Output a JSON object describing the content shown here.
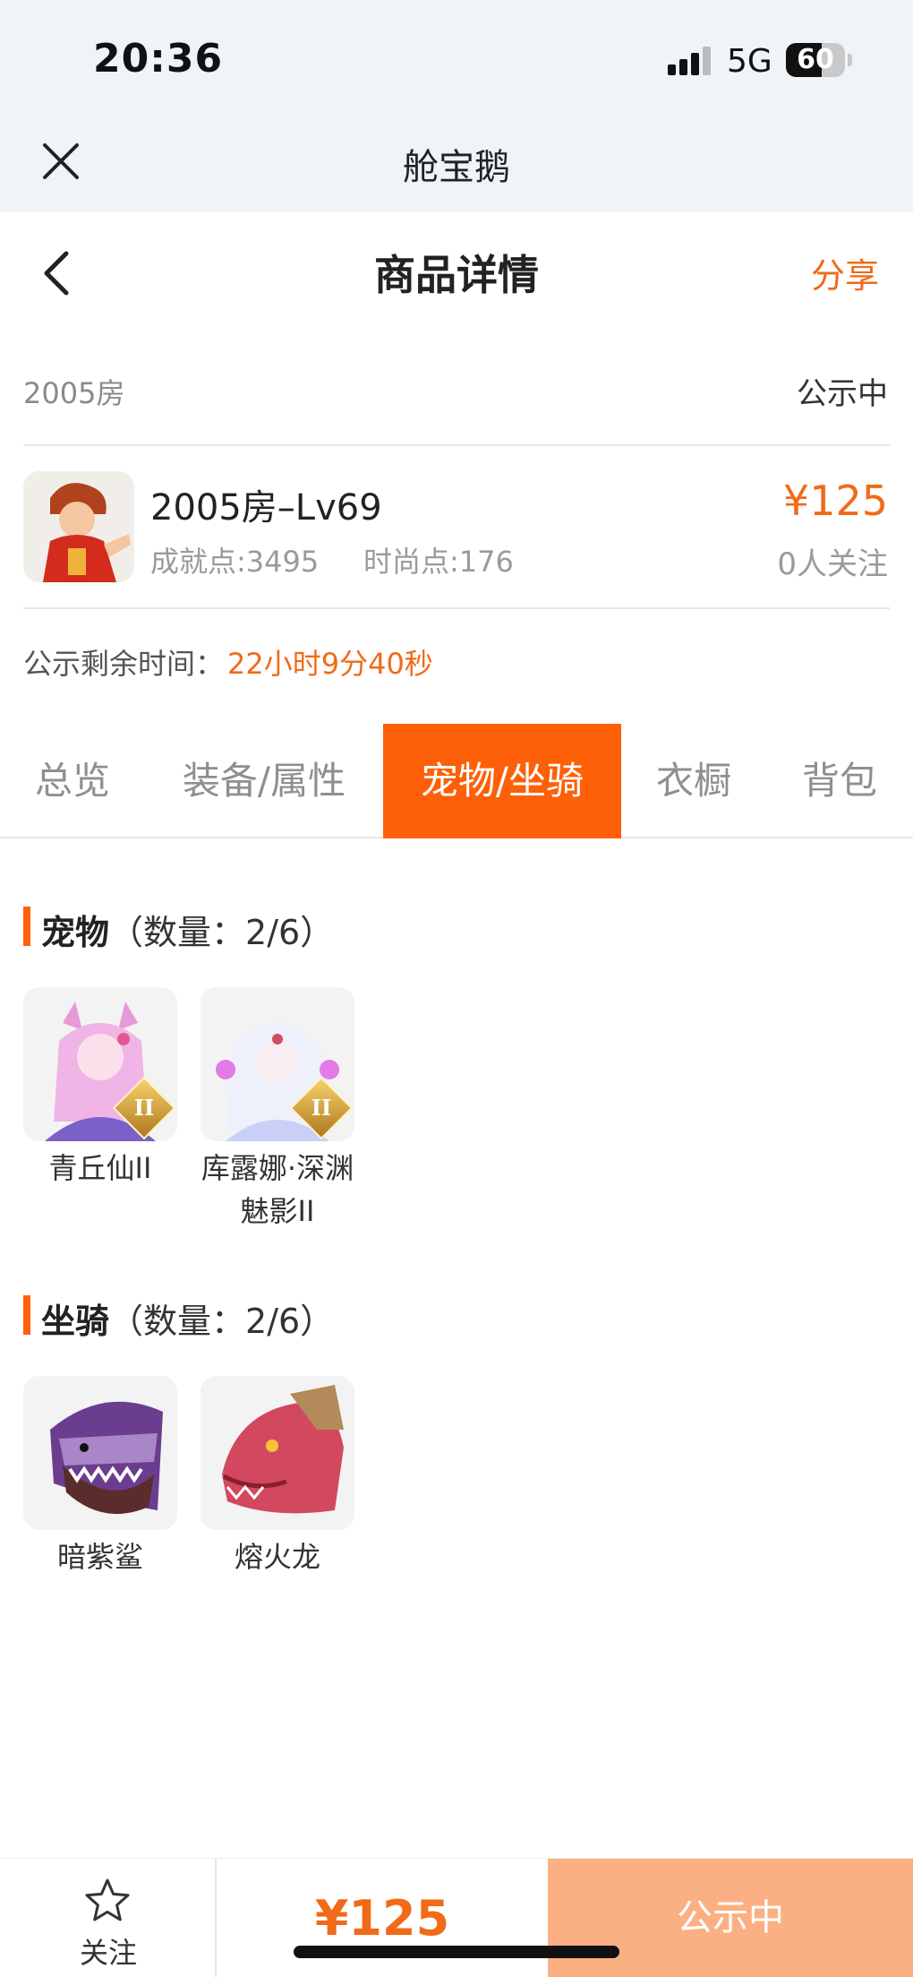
{
  "status_bar": {
    "time": "20:36",
    "network": "5G",
    "battery": "60",
    "battery_level": 0.6
  },
  "mini_app": {
    "title": "舱宝鹅",
    "close_icon": "close-icon"
  },
  "nav": {
    "title": "商品详情",
    "share": "分享",
    "back_icon": "chevron-left-icon"
  },
  "listing": {
    "room_label": "2005房",
    "status": "公示中",
    "name": "2005房–Lv69",
    "achievement": "成就点:3495",
    "fashion": "时尚点:176",
    "price": "¥125",
    "followers": "0人关注",
    "countdown_label": "公示剩余时间：",
    "countdown_value": "22小时9分40秒"
  },
  "tabs": [
    {
      "label": "总览",
      "active": false
    },
    {
      "label": "装备/属性",
      "active": false
    },
    {
      "label": "宠物/坐骑",
      "active": true
    },
    {
      "label": "衣橱",
      "active": false
    },
    {
      "label": "背包",
      "active": false
    }
  ],
  "pets": {
    "title": "宠物",
    "count": "（数量：2/6）",
    "items": [
      {
        "name": "青丘仙II",
        "rank": "II"
      },
      {
        "name": "库露娜·深渊魅影II",
        "rank": "II"
      }
    ]
  },
  "mounts": {
    "title": "坐骑",
    "count": "（数量：2/6）",
    "items": [
      {
        "name": "暗紫鲨"
      },
      {
        "name": "熔火龙"
      }
    ]
  },
  "bottom": {
    "follow_label": "关注",
    "follow_icon": "star-icon",
    "price": "¥125",
    "action": "公示中"
  },
  "colors": {
    "accent": "#fd6008",
    "price": "#f16a18",
    "action_bg": "#fbb083",
    "header_bg": "#eef4f8"
  }
}
